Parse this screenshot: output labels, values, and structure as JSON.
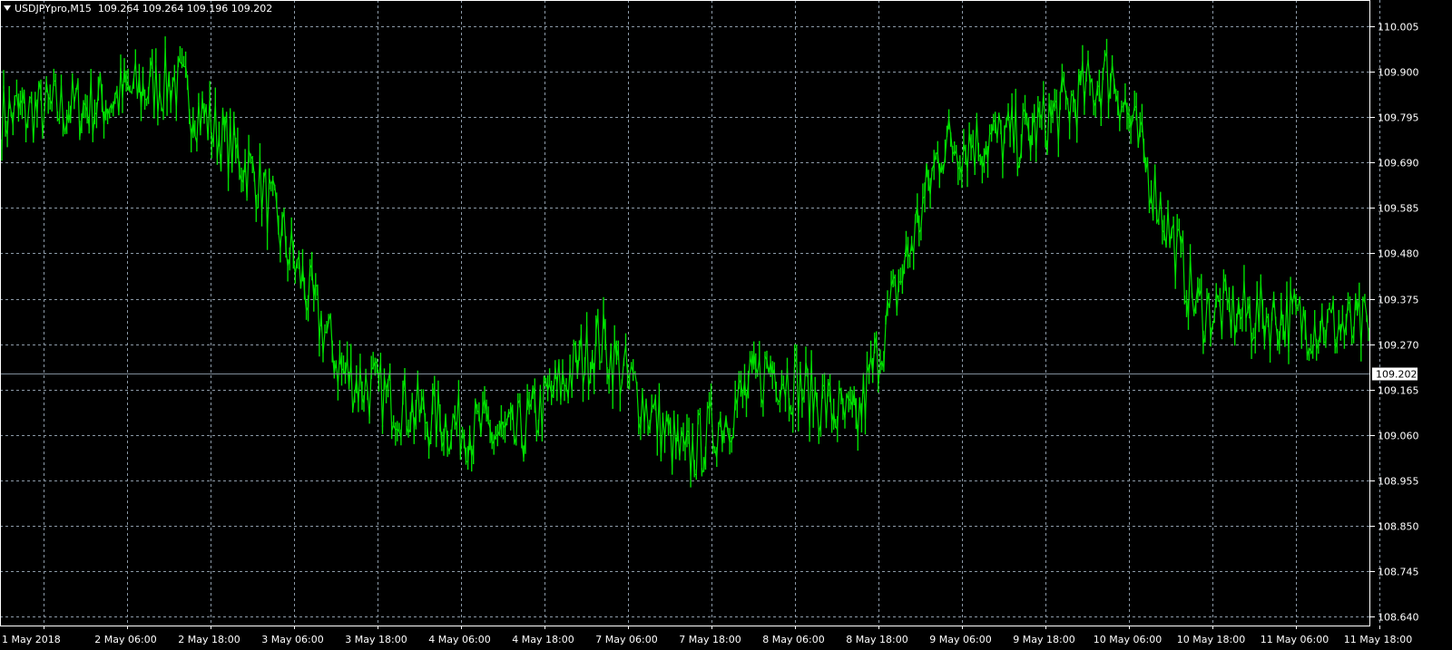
{
  "header": {
    "symbol": "USDJPYpro,M15",
    "ohlc": "109.264 109.264 109.196 109.202"
  },
  "colors": {
    "background": "#000000",
    "candle": "#00e000",
    "grid": "#8c9aa8",
    "axis_text": "#ffffff",
    "current_price_line": "#7f8d99"
  },
  "chart_data": {
    "type": "line",
    "symbol": "USDJPYpro",
    "timeframe": "M15",
    "y_ticks": [
      "110.005",
      "109.900",
      "109.795",
      "109.690",
      "109.585",
      "109.480",
      "109.375",
      "109.270",
      "109.165",
      "109.060",
      "108.955",
      "108.850",
      "108.745",
      "108.640"
    ],
    "ylim": [
      108.62,
      110.04
    ],
    "x_tick_labels": [
      "1 May 2018",
      "2 May 06:00",
      "2 May 18:00",
      "3 May 06:00",
      "3 May 18:00",
      "4 May 06:00",
      "4 May 18:00",
      "7 May 06:00",
      "7 May 18:00",
      "8 May 06:00",
      "8 May 18:00",
      "9 May 06:00",
      "9 May 18:00",
      "10 May 06:00",
      "10 May 18:00",
      "11 May 06:00",
      "11 May 18:00"
    ],
    "current_price": "109.202",
    "series": [
      {
        "x": [
          "1 May 2018",
          "2 May 06:00",
          "2 May 18:00",
          "3 May 06:00",
          "3 May 18:00",
          "4 May 06:00",
          "4 May 18:00",
          "7 May 06:00",
          "7 May 18:00",
          "8 May 06:00",
          "8 May 18:00",
          "9 May 06:00",
          "9 May 18:00",
          "10 May 06:00",
          "10 May 18:00",
          "11 May 06:00",
          "11 May 18:00"
        ],
        "values": [
          109.8,
          109.82,
          109.88,
          109.65,
          109.2,
          109.1,
          109.05,
          109.28,
          109.0,
          109.22,
          109.08,
          109.73,
          109.75,
          109.9,
          109.35,
          109.33,
          109.3
        ]
      }
    ],
    "grid": true
  }
}
